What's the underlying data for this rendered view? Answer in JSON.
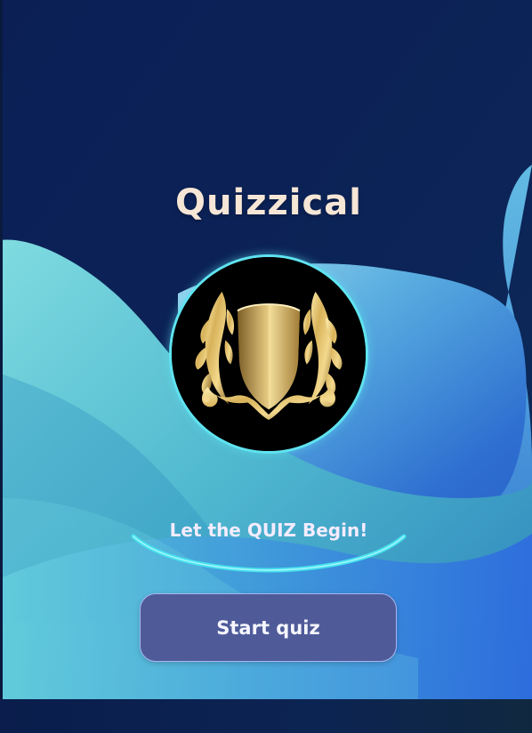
{
  "app": {
    "title": "Quizzical",
    "tagline": "Let the QUIZ Begin!",
    "start_button_label": "Start quiz"
  },
  "emblem": {
    "icon": "gold-shield-crest-icon"
  },
  "colors": {
    "background_top": "#0b1f4f",
    "wave_light": "#6fd2e3",
    "wave_blue": "#2f74d6",
    "title_text": "#f6e6d6",
    "emblem_ring": "#5fe3f0",
    "button_fill": "#4f5b99",
    "button_border": "#aab6f0",
    "tagline_arc": "#46e6f0"
  }
}
